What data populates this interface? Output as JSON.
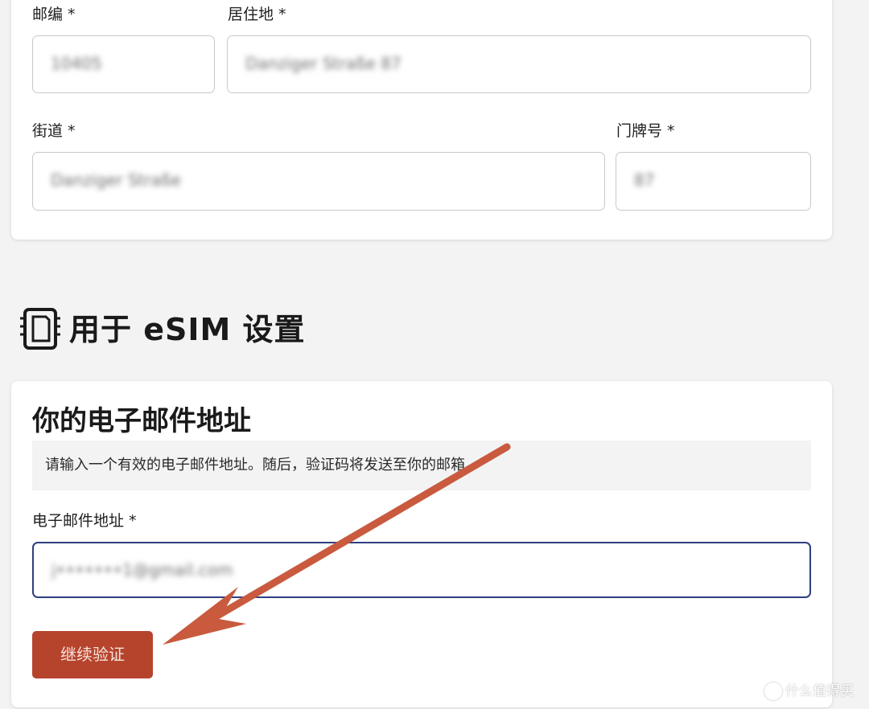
{
  "address_form": {
    "postcode": {
      "label": "邮编 *",
      "value": "10405"
    },
    "residence": {
      "label": "居住地 *",
      "value": "Danziger Straße 87"
    },
    "street": {
      "label": "街道 *",
      "value": "Danziger Straße"
    },
    "house_number": {
      "label": "门牌号 *",
      "value": "87"
    }
  },
  "esim_section": {
    "title": "用于 eSIM 设置",
    "icon": "esim-chip-icon"
  },
  "email_card": {
    "title": "你的电子邮件地址",
    "info": "请输入一个有效的电子邮件地址。随后，验证码将发送至你的邮箱。",
    "email_label": "电子邮件地址 *",
    "email_value": "j•••••••1@gmail.com",
    "continue_button": "继续验证"
  },
  "annotation": {
    "arrow_color": "#c95a3e",
    "icon": "arrow-annotation"
  },
  "watermark": {
    "logo_glyph": "值",
    "text": "什么值得买"
  },
  "colors": {
    "button_bg": "#b6442d",
    "focus_border": "#2f3f7f",
    "page_bg": "#f3f3f3"
  }
}
